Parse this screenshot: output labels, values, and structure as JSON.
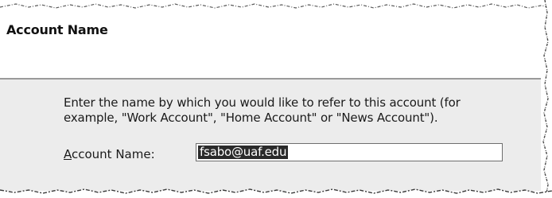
{
  "header": {
    "title": "Account Name"
  },
  "body": {
    "description_line1": "Enter the name by which you would like to refer to this account (for",
    "description_line2": "example, \"Work Account\", \"Home Account\" or \"News Account\").",
    "field_label_mnemonic": "A",
    "field_label_rest": "ccount Name:",
    "field_value": "fsabo@uaf.edu"
  },
  "colors": {
    "header_bg": "#ffffff",
    "body_bg": "#ececec",
    "divider": "#9a9a9a",
    "selection_bg": "#2a2a2a",
    "selection_text": "#ffffff"
  }
}
